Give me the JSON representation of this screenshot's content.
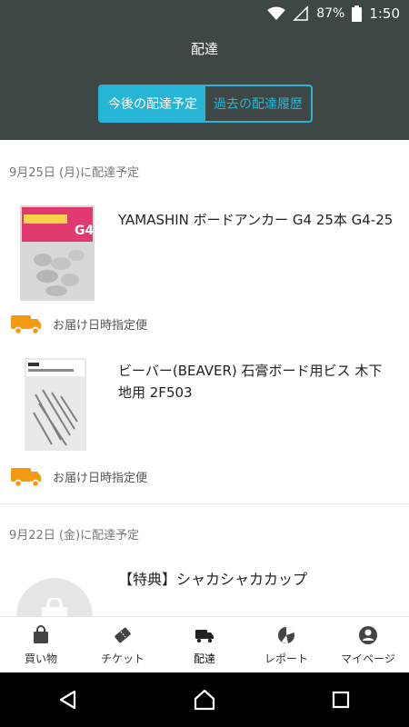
{
  "status_bar": {
    "battery": "87%",
    "time": "1:50"
  },
  "header": {
    "title": "配達",
    "segments": {
      "upcoming": "今後の配達予定",
      "past": "過去の配達履歴"
    }
  },
  "sections": [
    {
      "date_label": "9月25日 (月)に配達予定",
      "items": [
        {
          "name": "YAMASHIN ボードアンカー G4 25本 G4-25",
          "shipping": "お届け日時指定便"
        },
        {
          "name": "ビーバー(BEAVER) 石膏ボード用ビス 木下地用 2F503",
          "shipping": "お届け日時指定便"
        }
      ]
    },
    {
      "date_label": "9月22日 (金)に配達予定",
      "items": [
        {
          "name": "【特典】シャカシャカカップ"
        }
      ]
    }
  ],
  "tabs": [
    {
      "label": "買い物",
      "icon": "shopping-bag-icon"
    },
    {
      "label": "チケット",
      "icon": "ticket-icon"
    },
    {
      "label": "配達",
      "icon": "delivery-truck-icon"
    },
    {
      "label": "レポート",
      "icon": "report-icon"
    },
    {
      "label": "マイページ",
      "icon": "account-icon"
    }
  ],
  "colors": {
    "header_bg": "#3f4746",
    "accent": "#27b5d5",
    "truck": "#f39a12"
  }
}
